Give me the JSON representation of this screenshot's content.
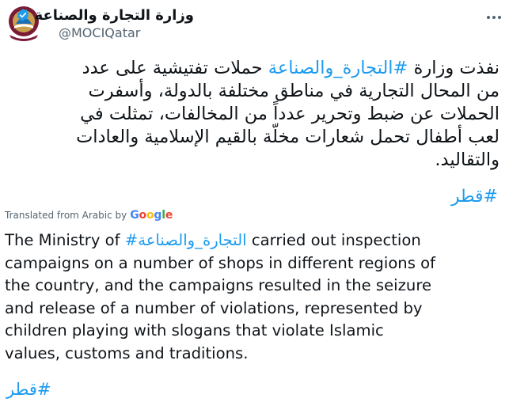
{
  "account": {
    "display_name": "وزارة التجارة والصناعة",
    "handle": "@MOCIQatar"
  },
  "tweet": {
    "arabic_lines": [
      "نفذت وزارة",
      "حملات تفتيشية على عدد",
      "من المحال التجارية في مناطق مختلفة بالدولة، وأسفرت",
      "الحملات عن ضبط وتحرير عدداً من المخالفات، تمثلت في",
      "لعب أطفال تحمل شعارات مخلّة بالقيم الإسلامية والعادات",
      "والتقاليد."
    ],
    "arabic_hashtag": "#التجارة_والصناعة",
    "hashtag_qatar": "#قطر"
  },
  "translation": {
    "label": "Translated from Arabic by",
    "google": [
      "G",
      "o",
      "o",
      "g",
      "l",
      "e"
    ],
    "english_first_prefix": "The Ministry of",
    "english_hashtag": "#التجارة_والصناعة",
    "english_first_suffix": "carried out inspection",
    "english_lines": [
      "campaigns on a number of shops in different regions of",
      "the country, and the campaigns resulted in the seizure",
      "and release of a number of violations, represented by",
      "children playing with slogans that violate Islamic",
      "values, customs and traditions."
    ],
    "hashtag_qatar": "#قطر"
  },
  "colors": {
    "link": "#1d9bf0",
    "verified": "#1d9bf0",
    "avatar_maroon": "#7a1b36",
    "avatar_gold": "#c9a14a"
  }
}
